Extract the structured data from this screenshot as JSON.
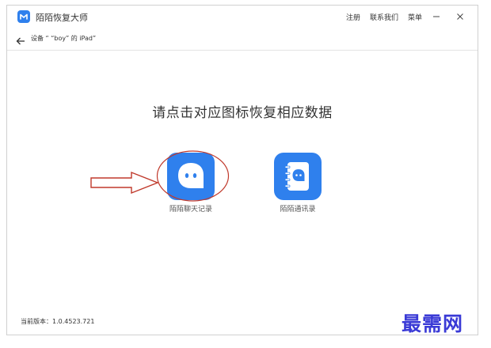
{
  "window": {
    "app_title": "陌陌恢复大师",
    "links": [
      "注册",
      "联系我们",
      "菜单"
    ],
    "min_icon": "minimize-icon",
    "close_icon": "close-icon"
  },
  "nav": {
    "back_icon": "arrow-left-icon",
    "device_label": "设备 “ “boy” 的 iPad”"
  },
  "main": {
    "headline": "请点击对应图标恢复相应数据",
    "apps": [
      {
        "label": "陌陌聊天记录",
        "icon": "chat-bubble-icon",
        "highlighted": true
      },
      {
        "label": "陌陌通讯录",
        "icon": "contact-book-icon",
        "highlighted": false
      }
    ]
  },
  "footer": {
    "version": "当前版本：1.0.4523.721"
  },
  "watermark": "最需网",
  "colors": {
    "brand_blue": "#2f80ed",
    "annotation_red": "#c0392b",
    "watermark_blue": "#3a3ad6"
  }
}
